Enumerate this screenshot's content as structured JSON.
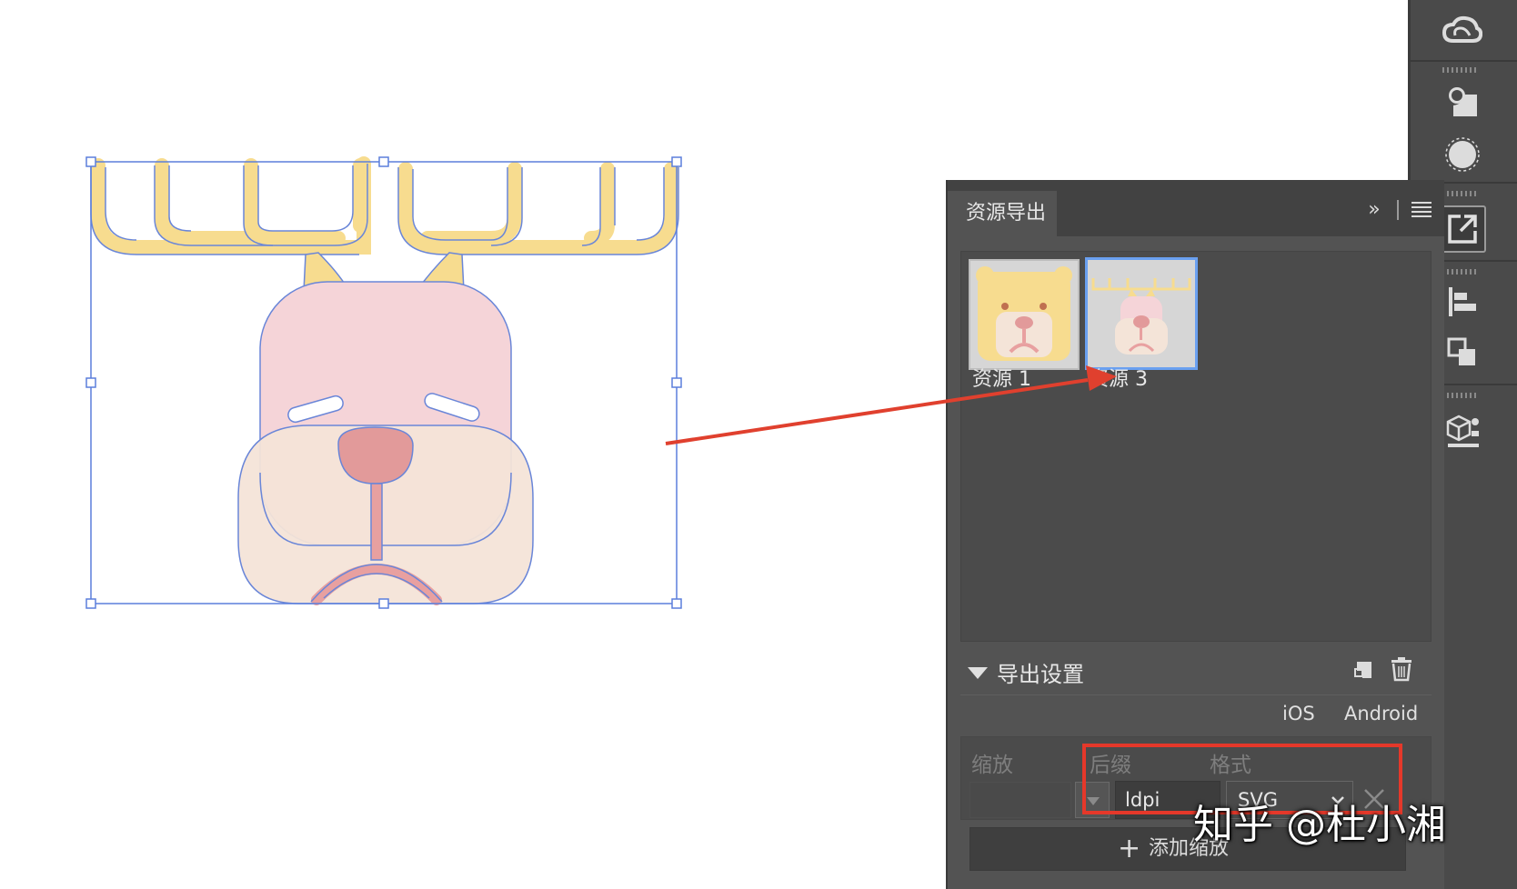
{
  "panel": {
    "tab_title": "资源导出",
    "collapse_glyph": "»",
    "menu_icon": "hamburger-icon",
    "assets": [
      {
        "label": "资源 1",
        "selected": false,
        "icon": "bear-face-thumbnail"
      },
      {
        "label": "资源 3",
        "selected": true,
        "icon": "deer-face-thumbnail"
      }
    ],
    "export_settings": {
      "title": "导出设置",
      "platform_tabs": [
        "iOS",
        "Android"
      ],
      "column_headers": [
        "缩放",
        "后缀",
        "格式"
      ],
      "rows": [
        {
          "scale": "",
          "suffix": "ldpi",
          "format": "SVG"
        }
      ],
      "add_scale_label": "添加缩放"
    }
  },
  "toolstrip": {
    "tools": [
      "creative-cloud-icon",
      "shape-builder-icon",
      "appearance-icon",
      "asset-export-icon",
      "align-icon",
      "pathfinder-icon",
      "3d-materials-icon"
    ],
    "active_tool": "asset-export-icon"
  },
  "artwork": {
    "name": "deer-face",
    "colors": {
      "antler": "#f7dc8f",
      "head": "#f5d4d8",
      "muzzle": "#f4e4d8",
      "nose": "#e29a9a",
      "mouth": "#e8a0a0",
      "selection": "#5b7fdc"
    }
  },
  "annotation": {
    "arrow_color": "#e0402e",
    "highlight_color": "#e5382a"
  },
  "watermark": "知乎 @杜小湘"
}
